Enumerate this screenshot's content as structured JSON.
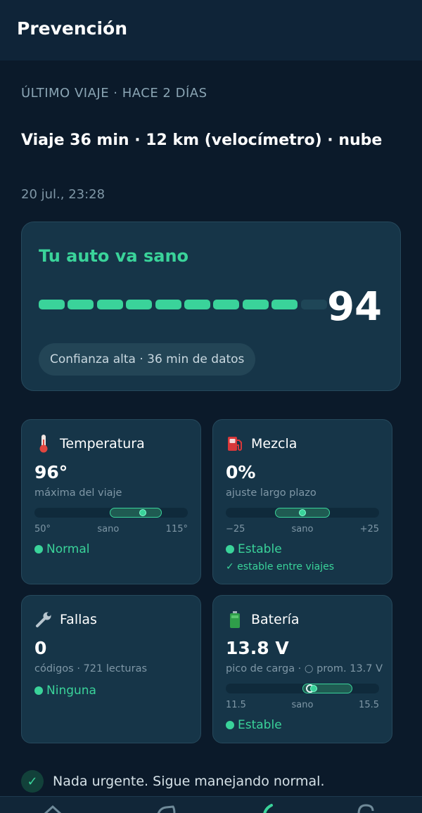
{
  "appbar": {
    "title": "Prevención"
  },
  "trip": {
    "section_label": "ÚLTIMO VIAJE · HACE 2 DÍAS",
    "title": "Viaje 36 min · 12 km (velocímetro) · nube",
    "date": "20 jul., 23:28"
  },
  "score": {
    "title": "Tu auto va sano",
    "value": "94",
    "segments_total": 10,
    "segments_filled": 9,
    "confidence": "Confianza alta · 36 min de datos"
  },
  "metrics": {
    "temperature": {
      "icon": "thermometer-icon",
      "title": "Temperatura",
      "value": "96°",
      "sub": "máxima del viaje",
      "range": {
        "min": 50,
        "max": 115,
        "healthy_min": 82,
        "healthy_max": 104,
        "current": 96
      },
      "range_min_label": "50°",
      "range_mid_label": "sano",
      "range_max_label": "115°",
      "status": "Normal"
    },
    "mixture": {
      "icon": "fuel-pump-icon",
      "title": "Mezcla",
      "value": "0%",
      "sub": "ajuste largo plazo",
      "range": {
        "min": -25,
        "max": 25,
        "healthy_min": -9,
        "healthy_max": 9,
        "current": 0
      },
      "range_min_label": "−25",
      "range_mid_label": "sano",
      "range_max_label": "+25",
      "status": "Estable",
      "note": "✓ estable entre viajes"
    },
    "faults": {
      "icon": "wrench-icon",
      "title": "Fallas",
      "value": "0",
      "sub": "códigos · 721 lecturas",
      "status": "Ninguna"
    },
    "battery": {
      "icon": "battery-icon",
      "title": "Batería",
      "value": "13.8 V",
      "sub": "pico de carga · ○ prom. 13.7 V",
      "range": {
        "min": 11.5,
        "max": 15.5,
        "healthy_min": 13.5,
        "healthy_max": 14.8,
        "current": 13.8,
        "average": 13.7
      },
      "range_min_label": "11.5",
      "range_mid_label": "sano",
      "range_max_label": "15.5",
      "status": "Estable"
    }
  },
  "footer": {
    "message": "Nada urgente. Sigue manejando normal."
  },
  "bottom_nav": {
    "items": [
      {
        "icon": "home-icon"
      },
      {
        "icon": "car-icon"
      },
      {
        "icon": "health-icon"
      },
      {
        "icon": "history-icon"
      }
    ]
  },
  "colors": {
    "background": "#0b1a2a",
    "card": "#163548",
    "accent": "#3ad39a",
    "muted_text": "#7f97a6"
  }
}
